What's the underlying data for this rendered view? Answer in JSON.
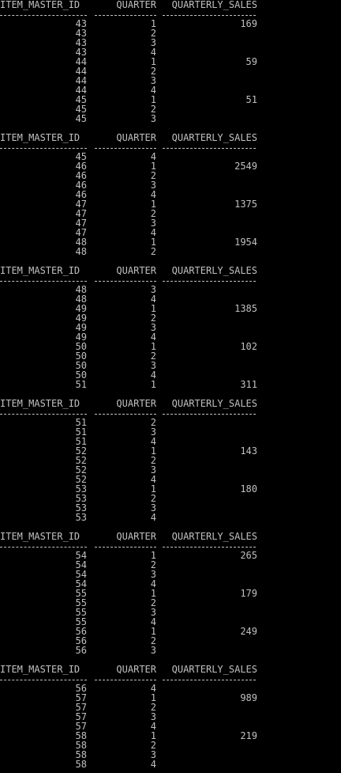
{
  "colors": {
    "background": "#000000",
    "text": "#c0c0c0"
  },
  "header": {
    "item_master_id": "ITEM_MASTER_ID",
    "quarter": "QUARTER",
    "quarterly_sales": "QUARTERLY_SALES"
  },
  "pages": [
    {
      "rows": [
        {
          "id": "43",
          "quarter": "1",
          "sales": "169"
        },
        {
          "id": "43",
          "quarter": "2",
          "sales": ""
        },
        {
          "id": "43",
          "quarter": "3",
          "sales": ""
        },
        {
          "id": "43",
          "quarter": "4",
          "sales": ""
        },
        {
          "id": "44",
          "quarter": "1",
          "sales": "59"
        },
        {
          "id": "44",
          "quarter": "2",
          "sales": ""
        },
        {
          "id": "44",
          "quarter": "3",
          "sales": ""
        },
        {
          "id": "44",
          "quarter": "4",
          "sales": ""
        },
        {
          "id": "45",
          "quarter": "1",
          "sales": "51"
        },
        {
          "id": "45",
          "quarter": "2",
          "sales": ""
        },
        {
          "id": "45",
          "quarter": "3",
          "sales": ""
        }
      ]
    },
    {
      "rows": [
        {
          "id": "45",
          "quarter": "4",
          "sales": ""
        },
        {
          "id": "46",
          "quarter": "1",
          "sales": "2549"
        },
        {
          "id": "46",
          "quarter": "2",
          "sales": ""
        },
        {
          "id": "46",
          "quarter": "3",
          "sales": ""
        },
        {
          "id": "46",
          "quarter": "4",
          "sales": ""
        },
        {
          "id": "47",
          "quarter": "1",
          "sales": "1375"
        },
        {
          "id": "47",
          "quarter": "2",
          "sales": ""
        },
        {
          "id": "47",
          "quarter": "3",
          "sales": ""
        },
        {
          "id": "47",
          "quarter": "4",
          "sales": ""
        },
        {
          "id": "48",
          "quarter": "1",
          "sales": "1954"
        },
        {
          "id": "48",
          "quarter": "2",
          "sales": ""
        }
      ]
    },
    {
      "rows": [
        {
          "id": "48",
          "quarter": "3",
          "sales": ""
        },
        {
          "id": "48",
          "quarter": "4",
          "sales": ""
        },
        {
          "id": "49",
          "quarter": "1",
          "sales": "1385"
        },
        {
          "id": "49",
          "quarter": "2",
          "sales": ""
        },
        {
          "id": "49",
          "quarter": "3",
          "sales": ""
        },
        {
          "id": "49",
          "quarter": "4",
          "sales": ""
        },
        {
          "id": "50",
          "quarter": "1",
          "sales": "102"
        },
        {
          "id": "50",
          "quarter": "2",
          "sales": ""
        },
        {
          "id": "50",
          "quarter": "3",
          "sales": ""
        },
        {
          "id": "50",
          "quarter": "4",
          "sales": ""
        },
        {
          "id": "51",
          "quarter": "1",
          "sales": "311"
        }
      ]
    },
    {
      "rows": [
        {
          "id": "51",
          "quarter": "2",
          "sales": ""
        },
        {
          "id": "51",
          "quarter": "3",
          "sales": ""
        },
        {
          "id": "51",
          "quarter": "4",
          "sales": ""
        },
        {
          "id": "52",
          "quarter": "1",
          "sales": "143"
        },
        {
          "id": "52",
          "quarter": "2",
          "sales": ""
        },
        {
          "id": "52",
          "quarter": "3",
          "sales": ""
        },
        {
          "id": "52",
          "quarter": "4",
          "sales": ""
        },
        {
          "id": "53",
          "quarter": "1",
          "sales": "180"
        },
        {
          "id": "53",
          "quarter": "2",
          "sales": ""
        },
        {
          "id": "53",
          "quarter": "3",
          "sales": ""
        },
        {
          "id": "53",
          "quarter": "4",
          "sales": ""
        }
      ]
    },
    {
      "rows": [
        {
          "id": "54",
          "quarter": "1",
          "sales": "265"
        },
        {
          "id": "54",
          "quarter": "2",
          "sales": ""
        },
        {
          "id": "54",
          "quarter": "3",
          "sales": ""
        },
        {
          "id": "54",
          "quarter": "4",
          "sales": ""
        },
        {
          "id": "55",
          "quarter": "1",
          "sales": "179"
        },
        {
          "id": "55",
          "quarter": "2",
          "sales": ""
        },
        {
          "id": "55",
          "quarter": "3",
          "sales": ""
        },
        {
          "id": "55",
          "quarter": "4",
          "sales": ""
        },
        {
          "id": "56",
          "quarter": "1",
          "sales": "249"
        },
        {
          "id": "56",
          "quarter": "2",
          "sales": ""
        },
        {
          "id": "56",
          "quarter": "3",
          "sales": ""
        }
      ]
    },
    {
      "rows": [
        {
          "id": "56",
          "quarter": "4",
          "sales": ""
        },
        {
          "id": "57",
          "quarter": "1",
          "sales": "989"
        },
        {
          "id": "57",
          "quarter": "2",
          "sales": ""
        },
        {
          "id": "57",
          "quarter": "3",
          "sales": ""
        },
        {
          "id": "57",
          "quarter": "4",
          "sales": ""
        },
        {
          "id": "58",
          "quarter": "1",
          "sales": "219"
        },
        {
          "id": "58",
          "quarter": "2",
          "sales": ""
        },
        {
          "id": "58",
          "quarter": "3",
          "sales": ""
        },
        {
          "id": "58",
          "quarter": "4",
          "sales": ""
        }
      ]
    }
  ]
}
